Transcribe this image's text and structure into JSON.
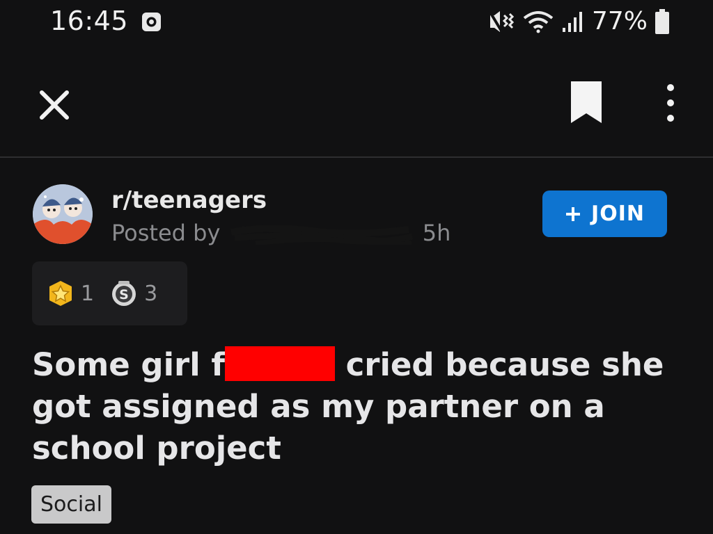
{
  "status_bar": {
    "time": "16:45",
    "battery_percent": "77%",
    "icons": [
      "notification-icon",
      "mute-vibrate-icon",
      "wifi-icon",
      "signal-icon",
      "battery-icon"
    ]
  },
  "app_bar": {
    "close_icon": "close-icon",
    "save_icon": "bookmark-icon",
    "more_icon": "more-vertical-icon"
  },
  "post": {
    "subreddit": "r/teenagers",
    "posted_by_prefix": "Posted by",
    "age": "5h",
    "join_label": "JOIN",
    "awards": [
      {
        "icon": "gold-star-award-icon",
        "count": "1"
      },
      {
        "icon": "silver-award-icon",
        "count": "3"
      }
    ],
    "title_before": "Some girl f",
    "title_after": "cried because she got assigned as my partner on a school project",
    "flair": "Social"
  },
  "colors": {
    "background": "#111112",
    "join_button": "#0e74d0",
    "redaction": "#ff0000",
    "flair_bg": "#c9c9ca"
  }
}
